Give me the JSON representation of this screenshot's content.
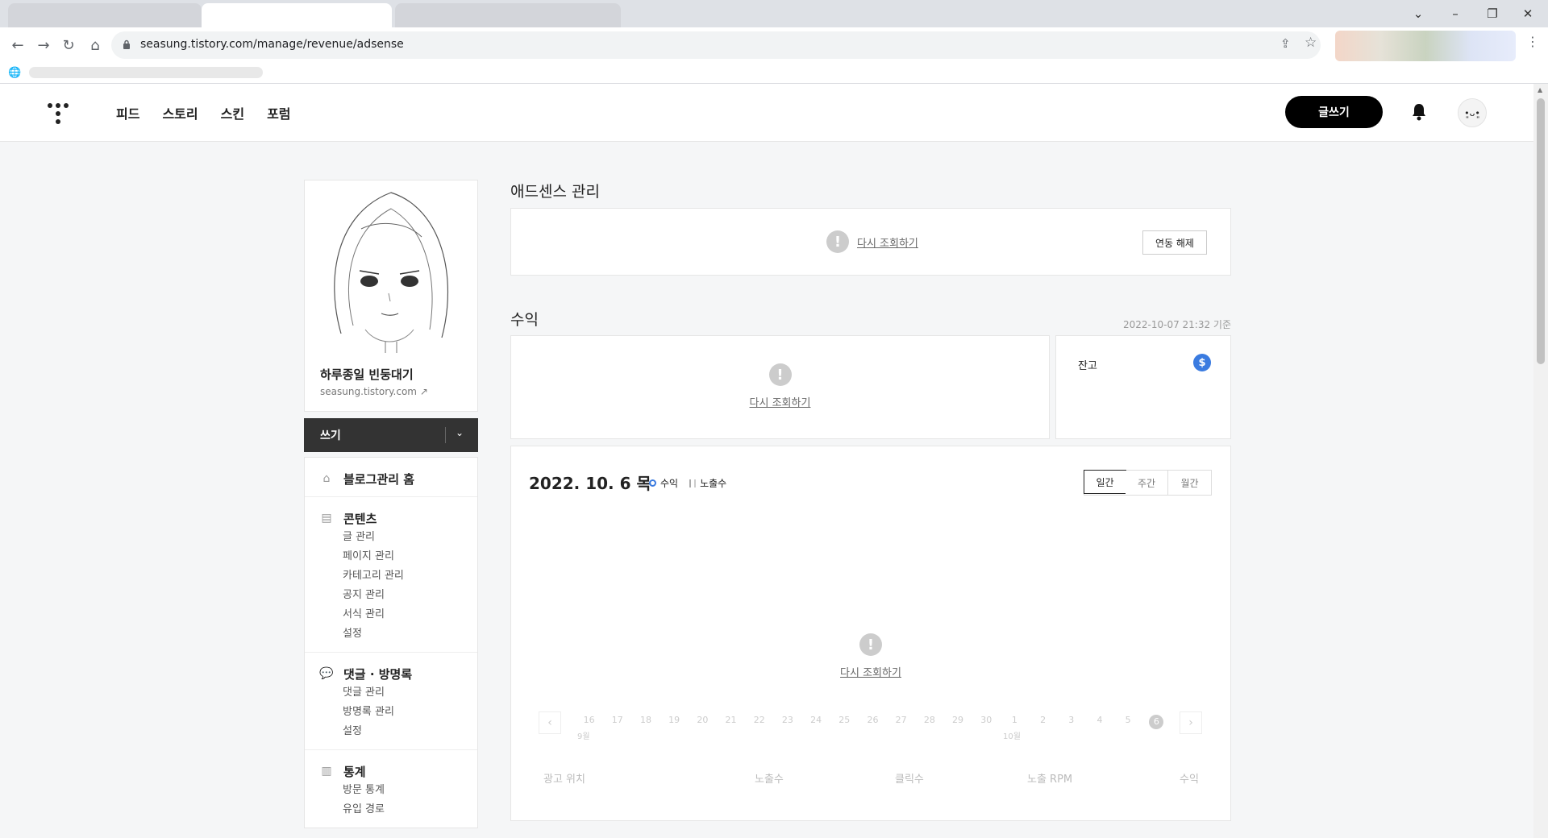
{
  "browser": {
    "url": "seasung.tistory.com/manage/revenue/adsense"
  },
  "header": {
    "nav": [
      "피드",
      "스토리",
      "스킨",
      "포럼"
    ],
    "write_button": "글쓰기"
  },
  "sidebar": {
    "blog_title": "하루종일 빈둥대기",
    "blog_url": "seasung.tistory.com",
    "write_bar": "쓰기",
    "sections": [
      {
        "title": "블로그관리 홈",
        "icon": "home-icon",
        "items": []
      },
      {
        "title": "콘텐츠",
        "icon": "document-icon",
        "items": [
          "글 관리",
          "페이지 관리",
          "카테고리 관리",
          "공지 관리",
          "서식 관리",
          "설정"
        ]
      },
      {
        "title": "댓글 · 방명록",
        "icon": "speech-bubble-icon",
        "items": [
          "댓글 관리",
          "방명록 관리",
          "설정"
        ]
      },
      {
        "title": "통계",
        "icon": "bar-chart-icon",
        "items": [
          "방문 통계",
          "유입 경로"
        ]
      }
    ]
  },
  "main": {
    "adsense_title": "애드센스 관리",
    "retry": "다시 조회하기",
    "unlink_button": "연동 해제",
    "revenue_title": "수익",
    "revenue_date": "2022-10-07 21:32 기준",
    "balance_label": "잔고",
    "balance_icon": "$",
    "chart_date": "2022. 10. 6 목",
    "legend": [
      "수익",
      "노출수"
    ],
    "period_tabs": [
      "일간",
      "주간",
      "월간"
    ],
    "days": [
      "16",
      "17",
      "18",
      "19",
      "20",
      "21",
      "22",
      "23",
      "24",
      "25",
      "26",
      "27",
      "28",
      "29",
      "30",
      "1",
      "2",
      "3",
      "4",
      "5",
      "6"
    ],
    "months": [
      "9월",
      "10월"
    ],
    "table_columns": [
      "광고 위치",
      "노출수",
      "클릭수",
      "노출 RPM",
      "수익"
    ]
  }
}
